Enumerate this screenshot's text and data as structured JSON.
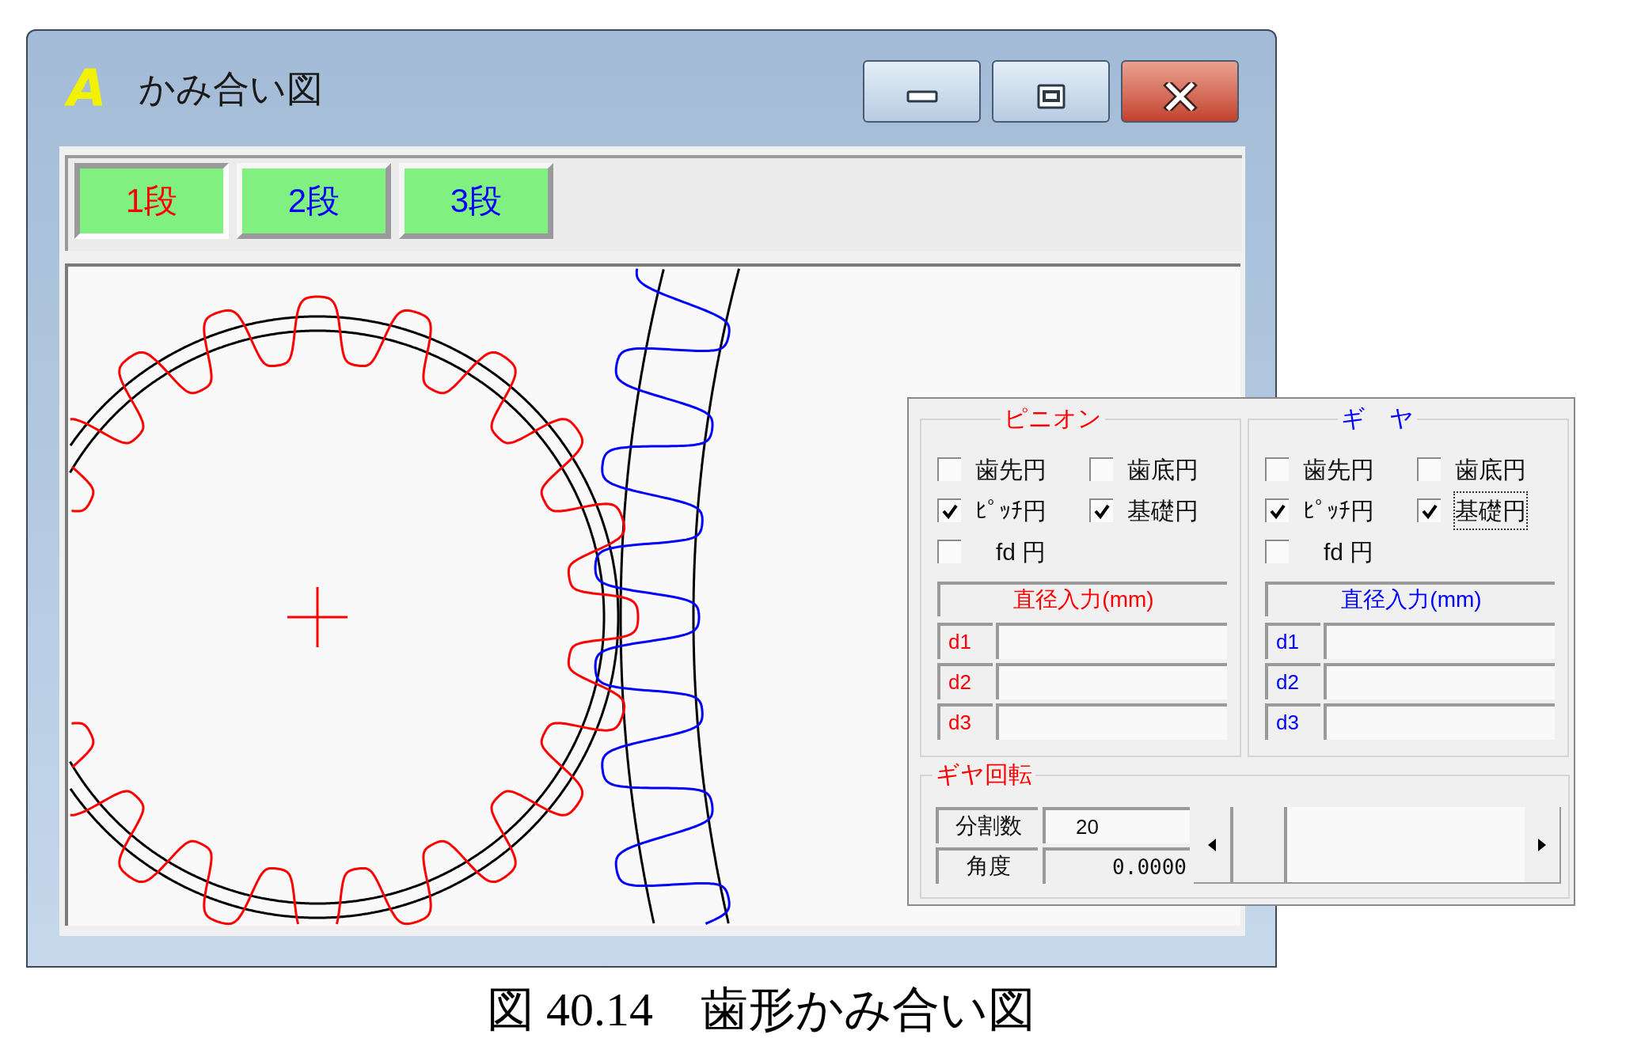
{
  "window": {
    "icon_letter": "A",
    "title": "かみ合い図"
  },
  "title_buttons": [
    {
      "kind": "minimize"
    },
    {
      "kind": "restore"
    },
    {
      "kind": "close"
    }
  ],
  "tabs": [
    {
      "label": "1段",
      "selected": true
    },
    {
      "label": "2段",
      "selected": false
    },
    {
      "label": "3段",
      "selected": false
    }
  ],
  "panel": {
    "groups": [
      {
        "kind": "pinion",
        "title": "ピニオン",
        "color": "#ff0000",
        "checkboxes": [
          {
            "kind": "tip",
            "label": "歯先円",
            "checked": false,
            "focused": false
          },
          {
            "kind": "root",
            "label": "歯底円",
            "checked": false,
            "focused": false
          },
          {
            "kind": "pitch",
            "label": "ﾋﾟｯﾁ円",
            "checked": true,
            "focused": false
          },
          {
            "kind": "base",
            "label": "基礎円",
            "checked": true,
            "focused": false
          },
          {
            "kind": "fd",
            "label": "fd 円",
            "checked": false,
            "focused": false
          }
        ],
        "diameter_header": "直径入力(mm)",
        "diameter_rows": [
          {
            "label": "d1"
          },
          {
            "label": "d2"
          },
          {
            "label": "d3"
          }
        ]
      },
      {
        "kind": "gear",
        "title": "ギ　ヤ",
        "color": "#0000ff",
        "checkboxes": [
          {
            "kind": "tip",
            "label": "歯先円",
            "checked": false,
            "focused": false
          },
          {
            "kind": "root",
            "label": "歯底円",
            "checked": false,
            "focused": false
          },
          {
            "kind": "pitch",
            "label": "ﾋﾟｯﾁ円",
            "checked": true,
            "focused": false
          },
          {
            "kind": "base",
            "label": "基礎円",
            "checked": true,
            "focused": true
          },
          {
            "kind": "fd",
            "label": "fd 円",
            "checked": false,
            "focused": false
          }
        ],
        "diameter_header": "直径入力(mm)",
        "diameter_rows": [
          {
            "label": "d1"
          },
          {
            "label": "d2"
          },
          {
            "label": "d3"
          }
        ]
      }
    ],
    "rotation": {
      "title": "ギヤ回転",
      "divisions": {
        "label": "分割数",
        "value": "20"
      },
      "angle": {
        "label": "角度",
        "value": "0.0000"
      }
    }
  },
  "caption": "図 40.14　歯形かみ合い図"
}
